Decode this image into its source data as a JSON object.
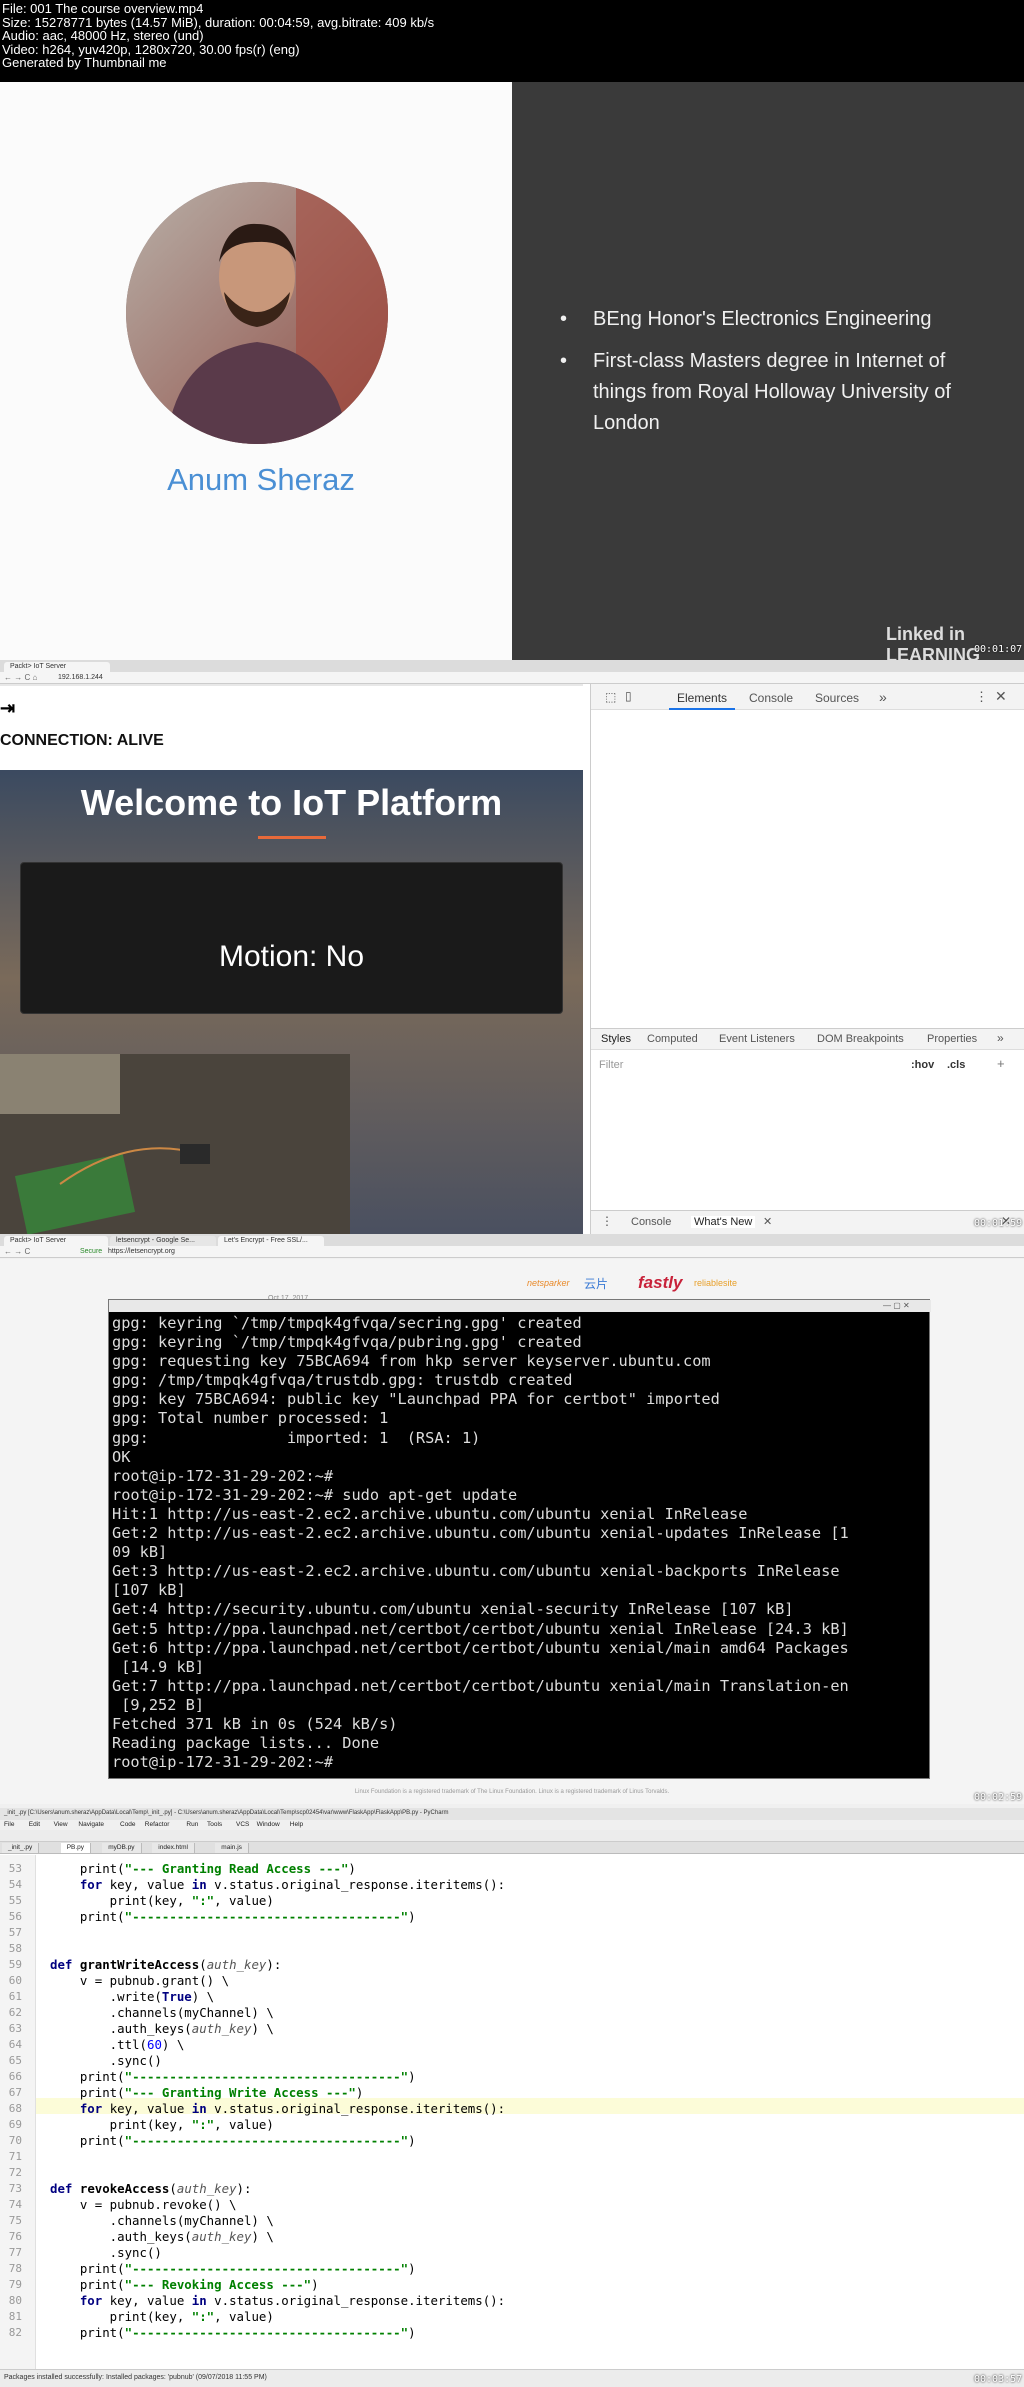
{
  "header": {
    "line1": "File: 001 The course overview.mp4",
    "line2": "Size: 15278771 bytes (14.57 MiB), duration: 00:04:59, avg.bitrate: 409 kb/s",
    "line3": "Audio: aac, 48000 Hz, stereo (und)",
    "line4": "Video: h264, yuv420p, 1280x720, 30.00 fps(r) (eng)",
    "line5": "Generated by Thumbnail me"
  },
  "frame1": {
    "name": "Anum Sheraz",
    "bullets": [
      "BEng Honor's Electronics Engineering",
      "First-class Masters degree in Internet of things from Royal Holloway University of London"
    ],
    "bullet_glyph": "•",
    "watermark": "Linked in LEARNING",
    "timestamp": "00:01:07"
  },
  "frame2": {
    "tab": "Packt> IoT Server",
    "url": "192.168.1.244",
    "logout_icon": "logout-icon",
    "connection": "CONNECTION: ALIVE",
    "welcome": "Welcome to IoT Platform",
    "motion": "Motion: No",
    "devtools_tabs": [
      "Elements",
      "Console",
      "Sources",
      "»"
    ],
    "styles_tabs": [
      "Styles",
      "Computed",
      "Event Listeners",
      "DOM Breakpoints",
      "Properties",
      "»"
    ],
    "filter": "Filter",
    "hov": ":hov",
    "cls": ".cls",
    "drawer_tabs": [
      "Console",
      "What's New"
    ],
    "timestamp": "00:01:59"
  },
  "frame3": {
    "tabs": [
      "Packt> IoT Server",
      "letsencrypt - Google Se...",
      "Let's Encrypt - Free SSL/..."
    ],
    "secure": "Secure",
    "url": "https://letsencrypt.org",
    "sponsors": [
      "netsparker",
      "云片",
      "fastly",
      "reliablesite"
    ],
    "date": "Oct 17, 2017",
    "terminal_lines": [
      "gpg: keyring `/tmp/tmpqk4gfvqa/secring.gpg' created",
      "gpg: keyring `/tmp/tmpqk4gfvqa/pubring.gpg' created",
      "gpg: requesting key 75BCA694 from hkp server keyserver.ubuntu.com",
      "gpg: /tmp/tmpqk4gfvqa/trustdb.gpg: trustdb created",
      "gpg: key 75BCA694: public key \"Launchpad PPA for certbot\" imported",
      "gpg: Total number processed: 1",
      "gpg:               imported: 1  (RSA: 1)",
      "OK",
      "root@ip-172-31-29-202:~#",
      "root@ip-172-31-29-202:~# sudo apt-get update",
      "Hit:1 http://us-east-2.ec2.archive.ubuntu.com/ubuntu xenial InRelease",
      "Get:2 http://us-east-2.ec2.archive.ubuntu.com/ubuntu xenial-updates InRelease [1",
      "09 kB]",
      "Get:3 http://us-east-2.ec2.archive.ubuntu.com/ubuntu xenial-backports InRelease",
      "[107 kB]",
      "Get:4 http://security.ubuntu.com/ubuntu xenial-security InRelease [107 kB]",
      "Get:5 http://ppa.launchpad.net/certbot/certbot/ubuntu xenial InRelease [24.3 kB]",
      "Get:6 http://ppa.launchpad.net/certbot/certbot/ubuntu xenial/main amd64 Packages",
      " [14.9 kB]",
      "Get:7 http://ppa.launchpad.net/certbot/certbot/ubuntu xenial/main Translation-en",
      " [9,252 B]",
      "Fetched 371 kB in 0s (524 kB/s)",
      "Reading package lists... Done",
      "root@ip-172-31-29-202:~# "
    ],
    "footer": "Linux Foundation is a registered trademark of The Linux Foundation. Linux is a registered trademark of Linus Torvalds.",
    "timestamp": "00:02:59"
  },
  "frame4": {
    "title": "_init_.py [C:\\Users\\anum.sheraz\\AppData\\Local\\Temp\\_init_.py] - C:\\Users\\anum.sheraz\\AppData\\Local\\Temp\\scp02454\\var\\www\\FlaskApp\\FlaskApp\\PB.py - PyCharm",
    "menu": [
      "File",
      "Edit",
      "View",
      "Navigate",
      "Code",
      "Refactor",
      "Run",
      "Tools",
      "VCS",
      "Window",
      "Help"
    ],
    "file_tabs": [
      "_init_.py",
      "PB.py",
      "myDB.py",
      "index.html",
      "main.js"
    ],
    "status": "Packages installed successfully: Installed packages: 'pubnub' (09/07/2018 11:55 PM)",
    "timestamp": "00:03:57",
    "code": [
      {
        "n": "53",
        "t": "    print(\"--- Granting Read Access ---\")"
      },
      {
        "n": "54",
        "t": "    for key, value in v.status.original_response.iteritems():"
      },
      {
        "n": "55",
        "t": "        print(key, \":\", value)"
      },
      {
        "n": "56",
        "t": "    print(\"------------------------------------\")"
      },
      {
        "n": "57",
        "t": ""
      },
      {
        "n": "58",
        "t": ""
      },
      {
        "n": "59",
        "t": "def grantWriteAccess(auth_key):"
      },
      {
        "n": "60",
        "t": "    v = pubnub.grant() \\"
      },
      {
        "n": "61",
        "t": "        .write(True) \\"
      },
      {
        "n": "62",
        "t": "        .channels(myChannel) \\"
      },
      {
        "n": "63",
        "t": "        .auth_keys(auth_key) \\"
      },
      {
        "n": "64",
        "t": "        .ttl(60) \\"
      },
      {
        "n": "65",
        "t": "        .sync()"
      },
      {
        "n": "66",
        "t": "    print(\"------------------------------------\")"
      },
      {
        "n": "67",
        "t": "    print(\"--- Granting Write Access ---\")"
      },
      {
        "n": "68",
        "t": "    for key, value in v.status.original_response.iteritems():"
      },
      {
        "n": "69",
        "t": "        print(key, \":\", value)"
      },
      {
        "n": "70",
        "t": "    print(\"------------------------------------\")"
      },
      {
        "n": "71",
        "t": ""
      },
      {
        "n": "72",
        "t": ""
      },
      {
        "n": "73",
        "t": "def revokeAccess(auth_key):"
      },
      {
        "n": "74",
        "t": "    v = pubnub.revoke() \\"
      },
      {
        "n": "75",
        "t": "        .channels(myChannel) \\"
      },
      {
        "n": "76",
        "t": "        .auth_keys(auth_key) \\"
      },
      {
        "n": "77",
        "t": "        .sync()"
      },
      {
        "n": "78",
        "t": "    print(\"------------------------------------\")"
      },
      {
        "n": "79",
        "t": "    print(\"--- Revoking Access ---\")"
      },
      {
        "n": "80",
        "t": "    for key, value in v.status.original_response.iteritems():"
      },
      {
        "n": "81",
        "t": "        print(key, \":\", value)"
      },
      {
        "n": "82",
        "t": "    print(\"------------------------------------\")"
      }
    ]
  }
}
